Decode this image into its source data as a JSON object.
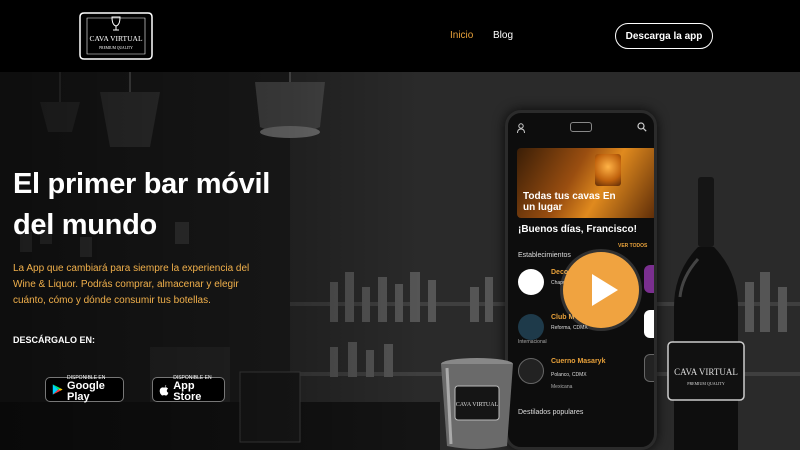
{
  "header": {
    "logo": {
      "brand": "CAVA VIRTUAL",
      "tagline": "PREMIUM QUALITY"
    },
    "nav": [
      {
        "label": "Inicio",
        "active": true
      },
      {
        "label": "Blog",
        "active": false
      }
    ],
    "cta_label": "Descarga la app"
  },
  "hero": {
    "title_line1": "El primer bar móvil",
    "title_line2": "del mundo",
    "description": "La App que cambiará para siempre la experiencia del Wine & Liquor. Podrás comprar, almacenar y elegir cuánto, cómo y dónde consumir tus botellas.",
    "download_label": "DESCÁRGALO EN:",
    "stores": {
      "google": {
        "small": "DISPONIBLE EN",
        "big": "Google Play"
      },
      "apple": {
        "small": "DISPONIBLE EN",
        "big": "App Store"
      }
    }
  },
  "phone": {
    "banner": "Todas tus cavas En un lugar",
    "greeting": "¡Buenos días, Francisco!",
    "establishments_label": "Establecimientos",
    "see_all": "VER TODOS",
    "establishments": [
      {
        "name": "Deco",
        "location": "Chapu",
        "category": "Restau"
      },
      {
        "name": "Club M",
        "location": "Reforma, CDMX",
        "category": "Internacional"
      },
      {
        "name": "Cuerno Masaryk",
        "location": "Polanco, CDMX",
        "category": "Mexicana"
      }
    ],
    "destilados_label": "Destilados populares"
  },
  "colors": {
    "accent": "#e8a13a",
    "play": "#f0a340",
    "background": "#000000"
  },
  "icons": {
    "play": "play-icon",
    "google_play": "google-play-icon",
    "apple": "apple-icon"
  }
}
